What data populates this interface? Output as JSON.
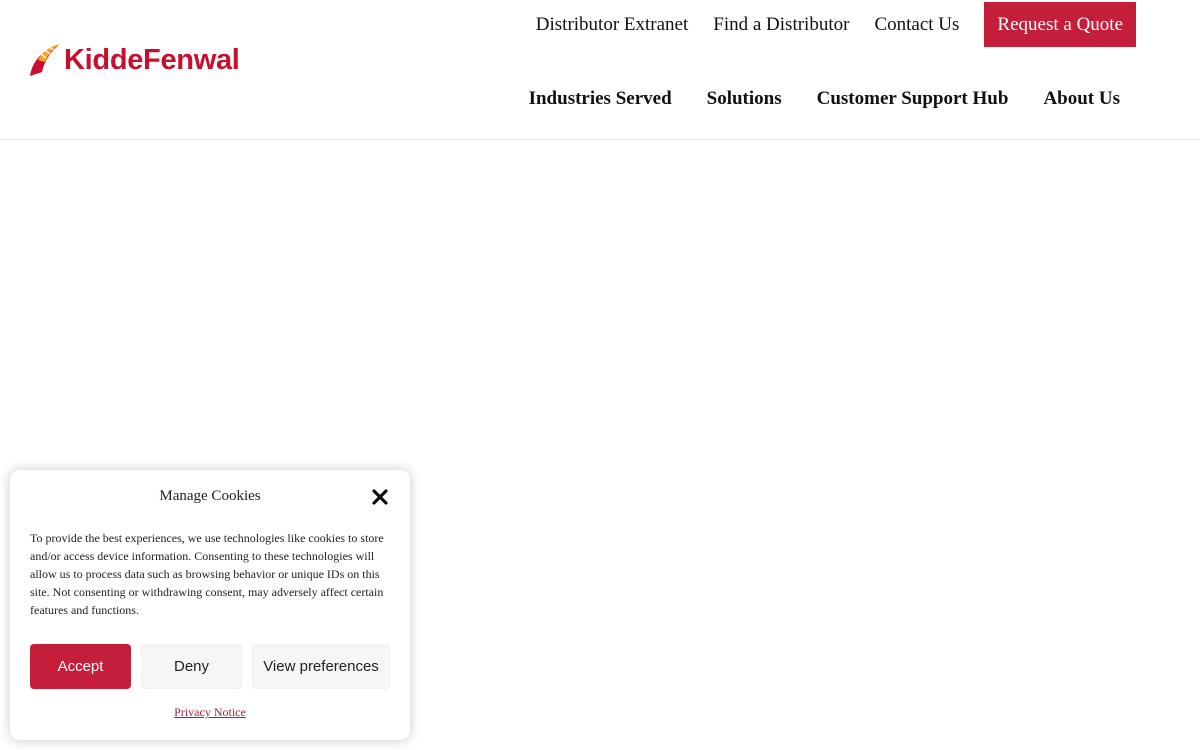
{
  "colors": {
    "brand_red": "#c8102e",
    "brand_orange": "#f5a623",
    "button_red": "#c41e3a",
    "link_red": "#a8203a",
    "text_dark": "#111111"
  },
  "header": {
    "logo": {
      "text": "KiddeFenwal",
      "icon": "flame-swoosh-icon"
    },
    "top_nav": [
      {
        "label": "Distributor Extranet"
      },
      {
        "label": "Find a Distributor"
      },
      {
        "label": "Contact Us"
      },
      {
        "label": "Request a Quote"
      }
    ],
    "main_nav": [
      {
        "label": "Industries Served"
      },
      {
        "label": "Solutions"
      },
      {
        "label": "Customer Support Hub"
      },
      {
        "label": "About Us"
      }
    ]
  },
  "cookie_banner": {
    "title": "Manage Cookies",
    "close_icon": "close-icon",
    "message": "To provide the best experiences, we use technologies like cookies to store and/or access device information. Consenting to these technologies will allow us to process data such as browsing behavior or unique IDs on this site. Not consenting or withdrawing consent, may adversely affect certain features and functions.",
    "buttons": {
      "accept": "Accept",
      "deny": "Deny",
      "preferences": "View preferences"
    },
    "privacy_link": "Privacy Notice"
  }
}
